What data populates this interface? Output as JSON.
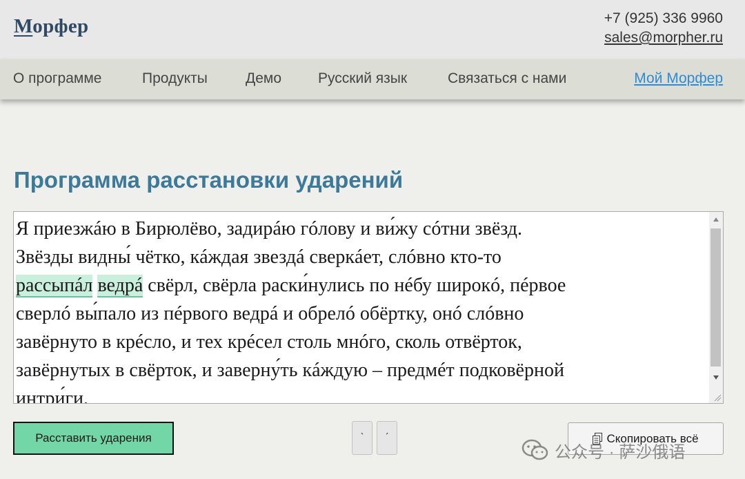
{
  "header": {
    "logo": {
      "first_letter": "М",
      "rest": "орфер"
    },
    "phone": "+7 (925) 336 9960",
    "email": "sales@morpher.ru"
  },
  "nav": {
    "items": [
      {
        "label": "О программе"
      },
      {
        "label": "Продукты"
      },
      {
        "label": "Демо"
      },
      {
        "label": "Русский язык"
      },
      {
        "label": "Связаться с нами"
      }
    ],
    "account_link": "Мой Морфер"
  },
  "main": {
    "heading": "Программа расстановки ударений",
    "editor": {
      "line1": "Я приезжáю в Бирюлёво, задирáю гóлову и ви́жу сóтни звёзд.",
      "line2": "Звёзды видны́ чётко, кáждая звездá сверкáет, слóвно кто-то",
      "line3_hl1": "рассыпáл",
      "line3_hl2": "ведрá",
      "line3_rest": " свёрл, свёрла раски́нулись по нéбу широкó, пéрвое",
      "line4": "сверлó вы́пало из пéрвого ведрá и обрелó обёртку, онó слóвно",
      "line5": "завёрнуто в крéсло, и тех крéсел столь мнóго, сколь отвёрток,",
      "line6": "завёрнутых в свёрток, и заверну́ть кáждую – предмéт подковёрной",
      "line7": "интри́ги."
    },
    "stress_button": "Расставить ударения",
    "accent_buttons": [
      "ˋ",
      "ˊ"
    ],
    "copy_button": "Скопировать всё"
  },
  "watermark": {
    "text": "公众号 · 萨沙俄语"
  },
  "colors": {
    "heading": "#3c7a9a",
    "accent_green": "#72d6a6",
    "link_blue": "#2f8bd4",
    "highlight": "#c9f0dc"
  }
}
